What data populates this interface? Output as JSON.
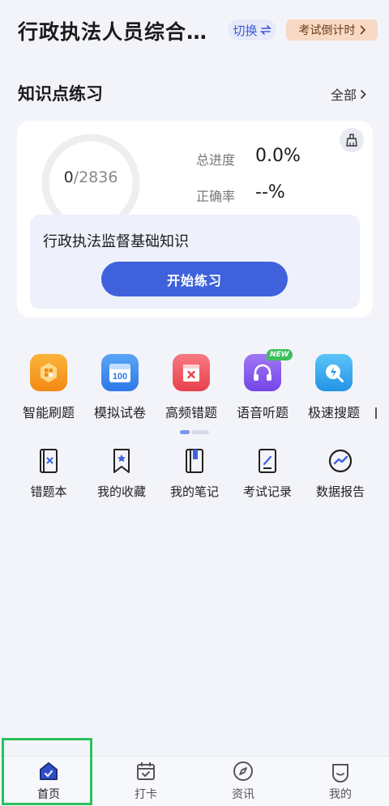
{
  "header": {
    "title": "行政执法人员综合…",
    "switch_label": "切换",
    "countdown_label": "考试倒计时"
  },
  "section": {
    "title": "知识点练习",
    "all_label": "全部"
  },
  "card": {
    "progress_done": "0",
    "progress_total": "2836",
    "progress_fraction": 0,
    "progress_label": "总进度",
    "progress_value": "0.0%",
    "accuracy_label": "正确率",
    "accuracy_value": "--%",
    "subject": "行政执法监督基础知识",
    "start_label": "开始练习"
  },
  "features": [
    {
      "label": "智能刷题",
      "icon": "smart-practice-icon",
      "color": "#F7A226"
    },
    {
      "label": "模拟试卷",
      "icon": "mock-exam-icon",
      "color": "#3C8CF0"
    },
    {
      "label": "高频错题",
      "icon": "frequent-errors-icon",
      "color": "#F0505A"
    },
    {
      "label": "语音听题",
      "icon": "voice-listen-icon",
      "color": "#8B5CF0"
    },
    {
      "label": "极速搜题",
      "icon": "quick-search-icon",
      "color": "#2FA9F0"
    }
  ],
  "new_badge": "NEW",
  "tools": [
    {
      "label": "错题本",
      "icon": "error-book-icon"
    },
    {
      "label": "我的收藏",
      "icon": "bookmark-icon"
    },
    {
      "label": "我的笔记",
      "icon": "notes-icon"
    },
    {
      "label": "考试记录",
      "icon": "exam-record-icon"
    },
    {
      "label": "数据报告",
      "icon": "data-report-icon"
    }
  ],
  "nav": [
    {
      "label": "首页",
      "icon": "home-icon",
      "active": true
    },
    {
      "label": "打卡",
      "icon": "calendar-check-icon",
      "active": false
    },
    {
      "label": "资讯",
      "icon": "compass-icon",
      "active": false
    },
    {
      "label": "我的",
      "icon": "profile-icon",
      "active": false
    }
  ],
  "colors": {
    "accent": "#3F62DC",
    "background": "#F3F4F9",
    "highlight": "#2CC05A"
  }
}
